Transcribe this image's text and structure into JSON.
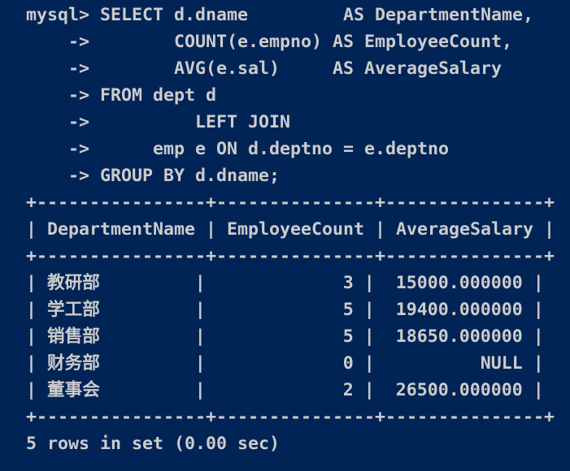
{
  "terminal": {
    "background": "#012456",
    "text_color": "#cccccc",
    "query_lines": [
      "mysql> SELECT d.dname         AS DepartmentName,",
      "    ->        COUNT(e.empno) AS EmployeeCount,",
      "    ->        AVG(e.sal)     AS AverageSalary",
      "    -> FROM dept d",
      "    ->          LEFT JOIN",
      "    ->      emp e ON d.deptno = e.deptno",
      "    -> GROUP BY d.dname;"
    ],
    "table_border": "+----------------+---------------+---------------+",
    "table_header": "| DepartmentName | EmployeeCount | AverageSalary |",
    "table_columns": [
      "DepartmentName",
      "EmployeeCount",
      "AverageSalary"
    ],
    "table_rows": [
      {
        "text": "| 教研部         |             3 |  15000.000000 |",
        "cells": [
          "教研部",
          "3",
          "15000.000000"
        ]
      },
      {
        "text": "| 学工部         |             5 |  19400.000000 |",
        "cells": [
          "学工部",
          "5",
          "19400.000000"
        ]
      },
      {
        "text": "| 销售部         |             5 |  18650.000000 |",
        "cells": [
          "销售部",
          "5",
          "18650.000000"
        ]
      },
      {
        "text": "| 财务部         |             0 |          NULL |",
        "cells": [
          "财务部",
          "0",
          "NULL"
        ]
      },
      {
        "text": "| 董事会         |             2 |  26500.000000 |",
        "cells": [
          "董事会",
          "2",
          "26500.000000"
        ]
      }
    ],
    "status_line": "5 rows in set (0.00 sec)"
  }
}
